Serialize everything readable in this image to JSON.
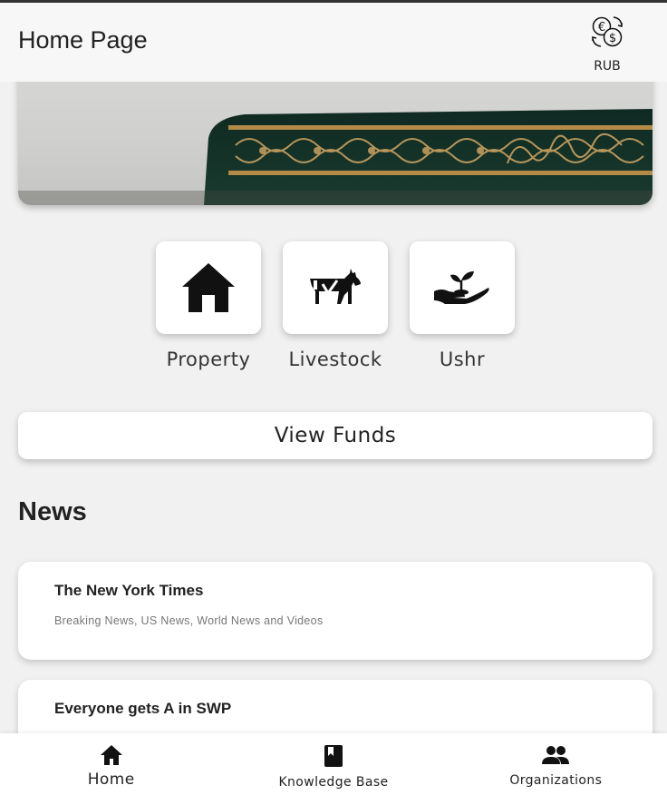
{
  "app_bar": {
    "title": "Home Page",
    "currency_icon": "currency-exchange-icon",
    "currency_label": "RUB"
  },
  "banner": {
    "image": "quran-book-photo"
  },
  "categories": [
    {
      "label": "Property",
      "icon": "house-icon"
    },
    {
      "label": "Livestock",
      "icon": "cow-icon"
    },
    {
      "label": "Ushr",
      "icon": "hand-plant-icon"
    }
  ],
  "view_funds_label": "View Funds",
  "news": {
    "heading": "News",
    "items": [
      {
        "title": "The New York Times",
        "subtitle": "Breaking News, US News, World News and Videos"
      },
      {
        "title": "Everyone gets A in SWP",
        "subtitle": ""
      }
    ]
  },
  "bottom_nav": {
    "items": [
      {
        "label": "Home",
        "icon": "home-icon",
        "active": true
      },
      {
        "label": "Knowledge Base",
        "icon": "book-icon",
        "active": false
      },
      {
        "label": "Organizations",
        "icon": "group-icon",
        "active": false
      }
    ]
  }
}
